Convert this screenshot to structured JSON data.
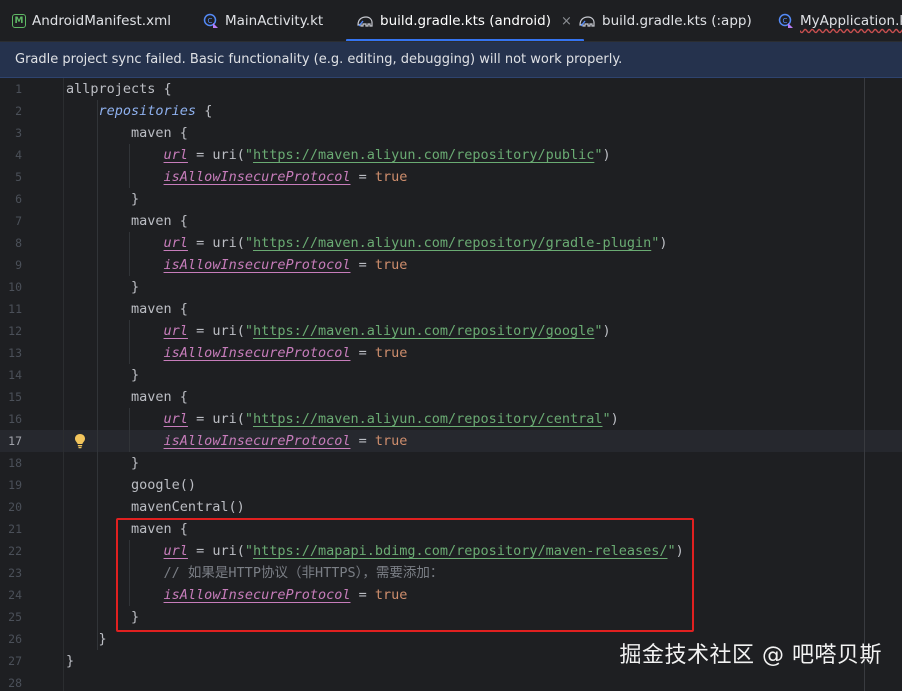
{
  "tabs": [
    {
      "label": "AndroidManifest.xml",
      "icon": "manifest-icon"
    },
    {
      "label": "MainActivity.kt",
      "icon": "kotlin-file-icon"
    },
    {
      "label": "build.gradle.kts (android)",
      "icon": "gradle-elephant-icon",
      "active": true,
      "close": "×"
    },
    {
      "label": "build.gradle.kts (:app)",
      "icon": "gradle-elephant-icon"
    },
    {
      "label": "MyApplication.kt",
      "icon": "kotlin-file-icon"
    }
  ],
  "manifest_glyph": "M",
  "banner": {
    "message": "Gradle project sync failed. Basic functionality (e.g. editing, debugging) will not work properly."
  },
  "editor": {
    "current_line": 17,
    "lines": [
      {
        "n": "1",
        "tokens": [
          [
            "kw",
            "allprojects {"
          ]
        ]
      },
      {
        "n": "2",
        "tokens": [
          [
            "kw",
            "    "
          ],
          [
            "ital",
            "repositories"
          ],
          [
            "kw",
            " {"
          ]
        ]
      },
      {
        "n": "3",
        "tokens": [
          [
            "kw",
            "        maven {"
          ]
        ]
      },
      {
        "n": "4",
        "tokens": [
          [
            "kw",
            "            "
          ],
          [
            "prop",
            "url"
          ],
          [
            "kw",
            " = uri("
          ],
          [
            "str",
            "\""
          ],
          [
            "strurl",
            "https://maven.aliyun.com/repository/public"
          ],
          [
            "str",
            "\""
          ],
          [
            "kw",
            ")"
          ]
        ]
      },
      {
        "n": "5",
        "tokens": [
          [
            "kw",
            "            "
          ],
          [
            "prop",
            "isAllowInsecureProtocol"
          ],
          [
            "kw",
            " = "
          ],
          [
            "bool",
            "true"
          ]
        ]
      },
      {
        "n": "6",
        "tokens": [
          [
            "kw",
            "        }"
          ]
        ]
      },
      {
        "n": "7",
        "tokens": [
          [
            "kw",
            "        maven {"
          ]
        ]
      },
      {
        "n": "8",
        "tokens": [
          [
            "kw",
            "            "
          ],
          [
            "prop",
            "url"
          ],
          [
            "kw",
            " = uri("
          ],
          [
            "str",
            "\""
          ],
          [
            "strurl",
            "https://maven.aliyun.com/repository/gradle-plugin"
          ],
          [
            "str",
            "\""
          ],
          [
            "kw",
            ")"
          ]
        ]
      },
      {
        "n": "9",
        "tokens": [
          [
            "kw",
            "            "
          ],
          [
            "prop",
            "isAllowInsecureProtocol"
          ],
          [
            "kw",
            " = "
          ],
          [
            "bool",
            "true"
          ]
        ]
      },
      {
        "n": "10",
        "tokens": [
          [
            "kw",
            "        }"
          ]
        ]
      },
      {
        "n": "11",
        "tokens": [
          [
            "kw",
            "        maven {"
          ]
        ]
      },
      {
        "n": "12",
        "tokens": [
          [
            "kw",
            "            "
          ],
          [
            "prop",
            "url"
          ],
          [
            "kw",
            " = uri("
          ],
          [
            "str",
            "\""
          ],
          [
            "strurl",
            "https://maven.aliyun.com/repository/google"
          ],
          [
            "str",
            "\""
          ],
          [
            "kw",
            ")"
          ]
        ]
      },
      {
        "n": "13",
        "tokens": [
          [
            "kw",
            "            "
          ],
          [
            "prop",
            "isAllowInsecureProtocol"
          ],
          [
            "kw",
            " = "
          ],
          [
            "bool",
            "true"
          ]
        ]
      },
      {
        "n": "14",
        "tokens": [
          [
            "kw",
            "        }"
          ]
        ]
      },
      {
        "n": "15",
        "tokens": [
          [
            "kw",
            "        maven {"
          ]
        ]
      },
      {
        "n": "16",
        "tokens": [
          [
            "kw",
            "            "
          ],
          [
            "prop",
            "url"
          ],
          [
            "kw",
            " = uri("
          ],
          [
            "str",
            "\""
          ],
          [
            "strurl",
            "https://maven.aliyun.com/repository/central"
          ],
          [
            "str",
            "\""
          ],
          [
            "kw",
            ")"
          ]
        ]
      },
      {
        "n": "17",
        "tokens": [
          [
            "kw",
            "            "
          ],
          [
            "prop",
            "isAllowInsecureProtocol"
          ],
          [
            "kw",
            " = "
          ],
          [
            "bool",
            "true"
          ]
        ]
      },
      {
        "n": "18",
        "tokens": [
          [
            "kw",
            "        }"
          ]
        ]
      },
      {
        "n": "19",
        "tokens": [
          [
            "kw",
            "        google()"
          ]
        ]
      },
      {
        "n": "20",
        "tokens": [
          [
            "kw",
            "        mavenCentral()"
          ]
        ]
      },
      {
        "n": "21",
        "tokens": [
          [
            "kw",
            "        maven {"
          ]
        ]
      },
      {
        "n": "22",
        "tokens": [
          [
            "kw",
            "            "
          ],
          [
            "prop",
            "url"
          ],
          [
            "kw",
            " = uri("
          ],
          [
            "str",
            "\""
          ],
          [
            "strurl",
            "https://mapapi.bdimg.com/repository/maven-releases/"
          ],
          [
            "str",
            "\""
          ],
          [
            "kw",
            ")"
          ]
        ]
      },
      {
        "n": "23",
        "tokens": [
          [
            "kw",
            "            "
          ],
          [
            "cmt",
            "// 如果是HTTP协议（非HTTPS），需要添加："
          ]
        ]
      },
      {
        "n": "24",
        "tokens": [
          [
            "kw",
            "            "
          ],
          [
            "prop",
            "isAllowInsecureProtocol"
          ],
          [
            "kw",
            " = "
          ],
          [
            "bool",
            "true"
          ]
        ]
      },
      {
        "n": "25",
        "tokens": [
          [
            "kw",
            "        }"
          ]
        ]
      },
      {
        "n": "26",
        "tokens": [
          [
            "kw",
            "    }"
          ]
        ]
      },
      {
        "n": "27",
        "tokens": [
          [
            "kw",
            "}"
          ]
        ]
      },
      {
        "n": "28",
        "tokens": []
      }
    ]
  },
  "watermark": "掘金技术社区 @ 吧嗒贝斯",
  "colors": {
    "accent": "#3574f0",
    "highlight_box": "#e02020",
    "string": "#6aab73",
    "property": "#c77dbb",
    "boolean": "#cf8e6d"
  }
}
